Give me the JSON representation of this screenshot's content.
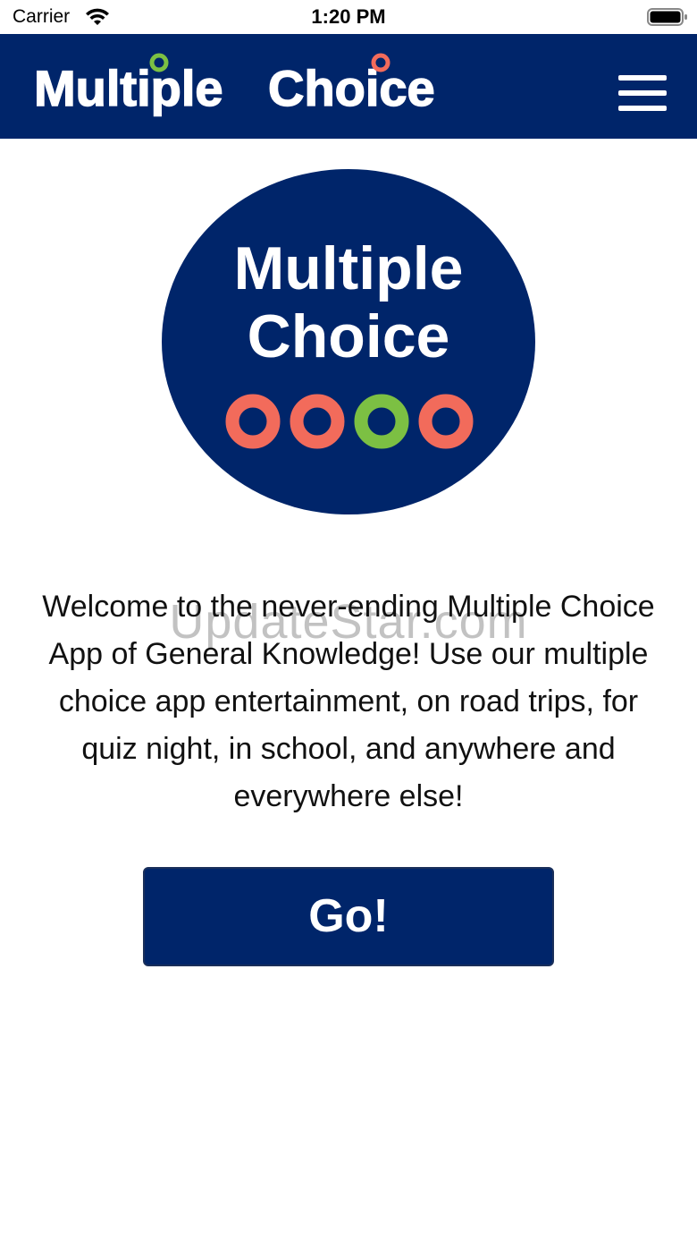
{
  "status_bar": {
    "carrier": "Carrier",
    "time": "1:20 PM"
  },
  "header": {
    "brand_word_1": "Multiple",
    "brand_word_2": "Choice",
    "menu_icon": "hamburger-menu-icon"
  },
  "hero": {
    "line_1": "Multiple",
    "line_2": "Choice",
    "dot_colors": [
      "#f26b5b",
      "#f26b5b",
      "#7cc043",
      "#f26b5b"
    ]
  },
  "welcome_text": "Welcome to the never-ending Multiple Choice App of General Knowledge! Use our multiple choice app entertainment, on road trips, for quiz night, in school, and anywhere and everywhere else!",
  "watermark": "UpdateStar.com",
  "go_button_label": "Go!",
  "colors": {
    "navy": "#00256a",
    "coral": "#f26b5b",
    "green": "#7cc043"
  }
}
